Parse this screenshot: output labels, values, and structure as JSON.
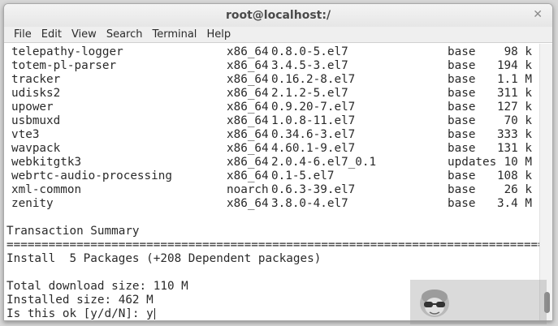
{
  "window": {
    "title": "root@localhost:/"
  },
  "menu": [
    "File",
    "Edit",
    "View",
    "Search",
    "Terminal",
    "Help"
  ],
  "packages": [
    {
      "name": "telepathy-logger",
      "arch": "x86_64",
      "version": "0.8.0-5.el7",
      "repo": "base",
      "size": "98 k"
    },
    {
      "name": "totem-pl-parser",
      "arch": "x86_64",
      "version": "3.4.5-3.el7",
      "repo": "base",
      "size": "194 k"
    },
    {
      "name": "tracker",
      "arch": "x86_64",
      "version": "0.16.2-8.el7",
      "repo": "base",
      "size": "1.1 M"
    },
    {
      "name": "udisks2",
      "arch": "x86_64",
      "version": "2.1.2-5.el7",
      "repo": "base",
      "size": "311 k"
    },
    {
      "name": "upower",
      "arch": "x86_64",
      "version": "0.9.20-7.el7",
      "repo": "base",
      "size": "127 k"
    },
    {
      "name": "usbmuxd",
      "arch": "x86_64",
      "version": "1.0.8-11.el7",
      "repo": "base",
      "size": "70 k"
    },
    {
      "name": "vte3",
      "arch": "x86_64",
      "version": "0.34.6-3.el7",
      "repo": "base",
      "size": "333 k"
    },
    {
      "name": "wavpack",
      "arch": "x86_64",
      "version": "4.60.1-9.el7",
      "repo": "base",
      "size": "131 k"
    },
    {
      "name": "webkitgtk3",
      "arch": "x86_64",
      "version": "2.0.4-6.el7_0.1",
      "repo": "updates",
      "size": "10 M"
    },
    {
      "name": "webrtc-audio-processing",
      "arch": "x86_64",
      "version": "0.1-5.el7",
      "repo": "base",
      "size": "108 k"
    },
    {
      "name": "xml-common",
      "arch": "noarch",
      "version": "0.6.3-39.el7",
      "repo": "base",
      "size": "26 k"
    },
    {
      "name": "zenity",
      "arch": "x86_64",
      "version": "3.8.0-4.el7",
      "repo": "base",
      "size": "3.4 M"
    }
  ],
  "summary": {
    "heading": "Transaction Summary",
    "separator": "================================================================================",
    "install_line": "Install  5 Packages (+208 Dependent packages)",
    "download_size": "Total download size: 110 M",
    "installed_size": "Installed size: 462 M",
    "prompt": "Is this ok [y/d/N]: y"
  },
  "icons": {
    "close": "close-icon",
    "mascot": "mascot-sunglasses-icon"
  }
}
